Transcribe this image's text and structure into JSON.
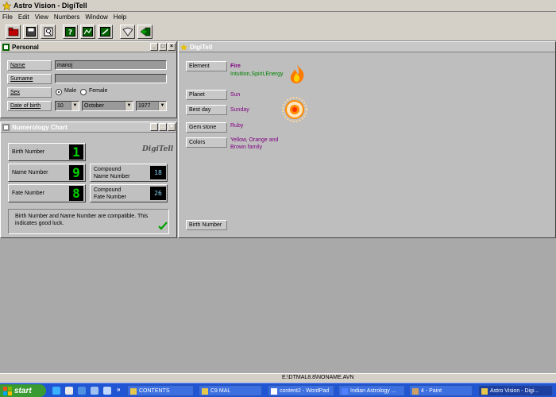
{
  "app": {
    "title": "Astro Vision - DigiTell"
  },
  "menu": [
    "File",
    "Edit",
    "View",
    "Numbers",
    "Window",
    "Help"
  ],
  "toolbar": {
    "icons": [
      "open-folder-icon",
      "save-icon",
      "print-preview-icon",
      "help-icon",
      "chart-icon",
      "tools-icon",
      "book-icon",
      "exit-icon"
    ]
  },
  "personal": {
    "title": "Personal",
    "name_label": "Name",
    "name_value": "manoj",
    "surname_label": "Surname",
    "surname_value": "",
    "sex_label": "Sex",
    "male_label": "Male",
    "female_label": "Female",
    "dob_label": "Date of birth",
    "dob_day": "10",
    "dob_month": "October",
    "dob_year": "1977"
  },
  "numerology": {
    "title": "Numerology Chart",
    "brand": "DigiTell",
    "birth_label": "Birth Number",
    "birth_value": "1",
    "name_label": "Name Number",
    "name_value": "9",
    "fate_label": "Fate Number",
    "fate_value": "8",
    "compound_name_label1": "Compound",
    "compound_name_label2": "Name Number",
    "compound_name_value": "18",
    "compound_fate_label1": "Compound",
    "compound_fate_label2": "Fate Number",
    "compound_fate_value": "26",
    "message": "Birth Number and Name Number are compatible. This indicates good luck."
  },
  "digitell": {
    "title": "DigiTell",
    "element_label": "Element",
    "element_value": "Fire",
    "element_desc": "Intuition,Spirit,Energy",
    "planet_label": "Planet",
    "planet_value": "Sun",
    "bestday_label": "Best day",
    "bestday_value": "Sunday",
    "gem_label": "Gem stone",
    "gem_value": "Ruby",
    "colors_label": "Colors",
    "colors_value_1": "Yellow, Orange and",
    "colors_value_2": "Brown family",
    "footer_label": "Birth Number"
  },
  "status": {
    "path": "E:\\DTMAL8.8\\NONAME.AVN"
  },
  "taskbar": {
    "start": "start",
    "items": [
      "CONTENTS",
      "C9 MAL",
      "content2 - WordPad",
      "Indian Astrology ...",
      "4 - Paint",
      "Astro Vision - Digi..."
    ]
  }
}
